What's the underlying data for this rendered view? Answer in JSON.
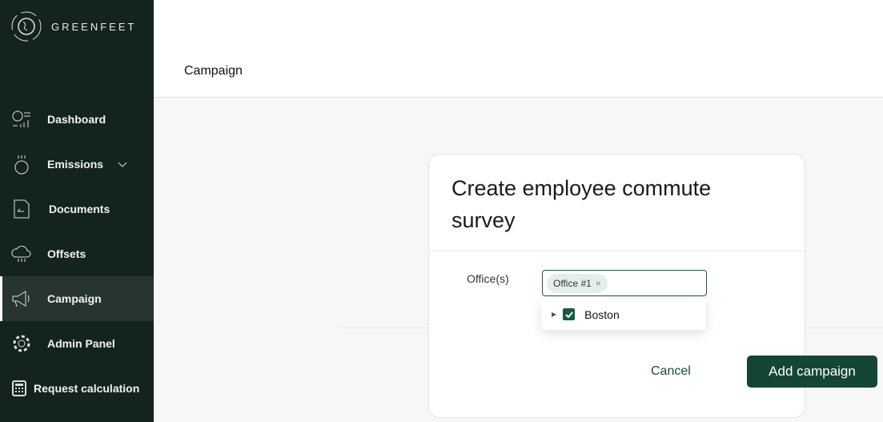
{
  "brand": {
    "name": "GREENFEET"
  },
  "sidebar": {
    "items": [
      {
        "label": "Dashboard",
        "icon": "dashboard-icon"
      },
      {
        "label": "Emissions",
        "icon": "emissions-icon",
        "has_chevron": true
      },
      {
        "label": "Documents",
        "icon": "document-icon"
      },
      {
        "label": "Offsets",
        "icon": "co2-cloud-icon"
      },
      {
        "label": "Campaign",
        "icon": "megaphone-icon",
        "active": true
      },
      {
        "label": "Admin Panel",
        "icon": "gear-icon"
      },
      {
        "label": "Request calculation",
        "icon": "calculator-icon"
      }
    ]
  },
  "header": {
    "title": "Campaign"
  },
  "dialog": {
    "title": "Create employee commute survey",
    "office_label": "Office(s)",
    "selected_tags": [
      "Office #1"
    ],
    "dropdown_options": [
      {
        "label": "Boston",
        "checked": true
      }
    ],
    "cancel_label": "Cancel",
    "submit_label": "Add campaign"
  },
  "colors": {
    "sidebar": "#132420",
    "accent": "#154634"
  }
}
